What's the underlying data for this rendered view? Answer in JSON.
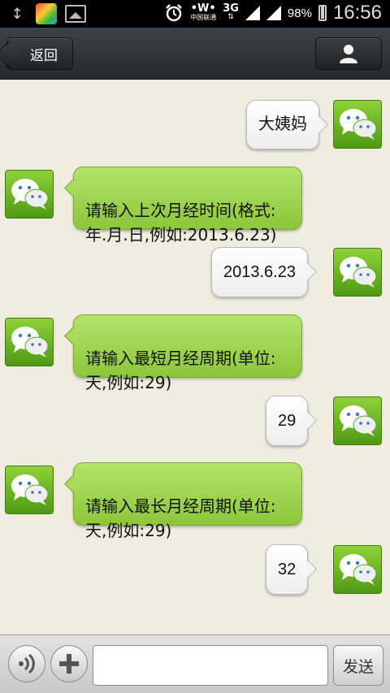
{
  "status_bar": {
    "icons_left": [
      "usb-icon",
      "app-icon",
      "gallery-icon"
    ],
    "carrier_top": "中国联通",
    "network_type": "3G",
    "battery_percent": "98%",
    "time": "16:56"
  },
  "titlebar": {
    "back_label": "返回",
    "profile_icon": "person-icon"
  },
  "messages": [
    {
      "side": "out",
      "text": "大姨妈"
    },
    {
      "side": "in",
      "text": "请输入上次月经时间(格式:\n年.月.日,例如:2013.6.23)"
    },
    {
      "side": "out",
      "text": "2013.6.23"
    },
    {
      "side": "in",
      "text": "请输入最短月经周期(单位:\n天,例如:29)"
    },
    {
      "side": "out",
      "text": "29"
    },
    {
      "side": "in",
      "text": "请输入最长月经周期(单位:\n天,例如:29)"
    },
    {
      "side": "out",
      "text": "32"
    }
  ],
  "input_bar": {
    "voice_icon": "voice-icon",
    "plus_icon": "plus-icon",
    "input_value": "",
    "send_label": "发送"
  },
  "colors": {
    "chat_background": "#f0ede0",
    "incoming_bubble": "#9fd150",
    "outgoing_bubble": "#ffffff",
    "titlebar": "#2f3337"
  }
}
